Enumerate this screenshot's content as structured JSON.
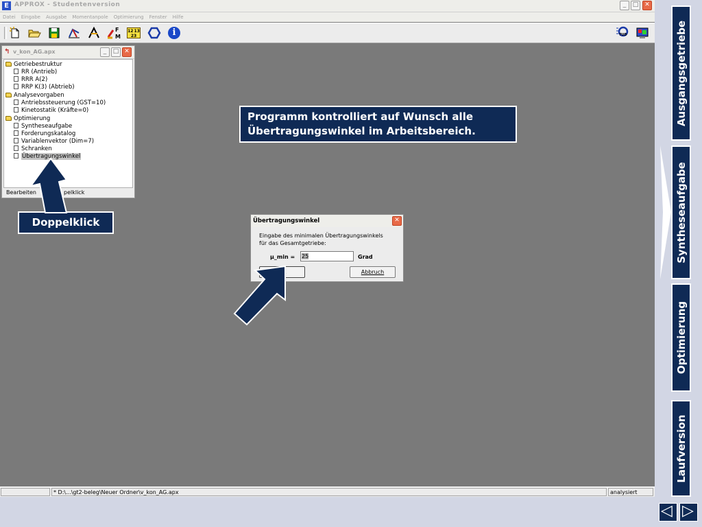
{
  "window": {
    "title": "APPROX - Studentenversion",
    "minimize": "_",
    "maximize": "□",
    "close": "✕"
  },
  "menu": [
    "Datei",
    "Eingabe",
    "Ausgabe",
    "Momentanpole",
    "Optimierung",
    "Fenster",
    "Hilfe"
  ],
  "toolbar": {
    "icons": [
      "new-file-icon",
      "open-folder-icon",
      "save-icon",
      "mechanism-icon",
      "linkage-icon",
      "force-icon",
      "table-icon",
      "hexagon-icon",
      "info-icon",
      "tud-logo-icon",
      "display-icon"
    ],
    "table_text": "12 13 23",
    "force_label_f": "F",
    "force_label_m": "M",
    "info_glyph": "i",
    "logo_text": "TUD"
  },
  "document": {
    "title": "v_kon_AG.apx",
    "tree": [
      {
        "label": "Getriebestruktur",
        "type": "folder",
        "level": 0
      },
      {
        "label": "RR (Antrieb)",
        "type": "page",
        "level": 1
      },
      {
        "label": "RRR A(2)",
        "type": "page",
        "level": 1
      },
      {
        "label": "RRP K(3) (Abtrieb)",
        "type": "page",
        "level": 1
      },
      {
        "label": "Analysevorgaben",
        "type": "folder",
        "level": 0
      },
      {
        "label": "Antriebssteuerung (GST=10)",
        "type": "page",
        "level": 1
      },
      {
        "label": "Kinetostatik (Kräfte=0)",
        "type": "page",
        "level": 1
      },
      {
        "label": "Optimierung",
        "type": "folder",
        "level": 0
      },
      {
        "label": "Syntheseaufgabe",
        "type": "page",
        "level": 1
      },
      {
        "label": "Forderungskatalog",
        "type": "page",
        "level": 1
      },
      {
        "label": "Variablenvektor (Dim=7)",
        "type": "page",
        "level": 1
      },
      {
        "label": "Schranken",
        "type": "page",
        "level": 1
      },
      {
        "label": "Übertragungswinkel",
        "type": "page",
        "level": 1,
        "selected": true
      }
    ],
    "status_left": "Bearbeiten",
    "status_right": "pelklick"
  },
  "callouts": {
    "info": "Programm kontrolliert auf Wunsch alle Übertragungswinkel im Arbeitsbereich.",
    "info_line1": "Programm kontrolliert auf Wunsch alle",
    "info_line2": "Übertragungswinkel im Arbeitsbereich.",
    "doppelklick": "Doppelklick"
  },
  "dialog": {
    "title": "Übertragungswinkel",
    "description_line1": "Eingabe des minimalen Übertragungswinkels",
    "description_line2": "für das Gesamtgetriebe:",
    "field_label": "µ_min =",
    "field_value": "25",
    "unit": "Grad",
    "ok_label": "OK",
    "cancel_label": "Abbruch"
  },
  "statusbar": {
    "path": "* D:\\...\\gt2-beleg\\Neuer Ordner\\v_kon_AG.apx",
    "state": "analysiert"
  },
  "sidebar": {
    "tabs": [
      {
        "label": "Ausgangsgetriebe",
        "active": false
      },
      {
        "label": "Syntheseaufgabe",
        "active": true
      },
      {
        "label": "Optimierung",
        "active": false
      },
      {
        "label": "Laufversion",
        "active": false
      }
    ],
    "prev": "◁",
    "next": "▷"
  },
  "colors": {
    "accent_navy": "#0f2a55",
    "workspace_gray": "#7a7a7a",
    "slide_background": "#d2d6e4"
  }
}
